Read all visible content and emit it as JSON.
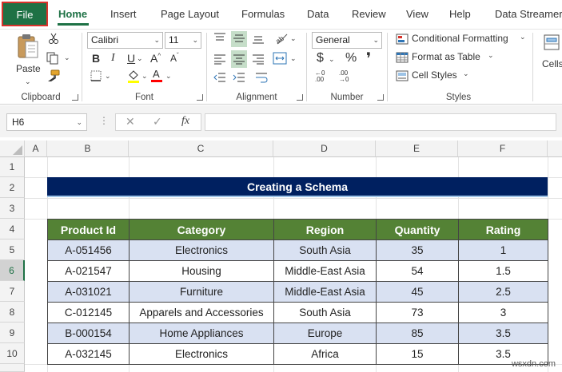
{
  "tabs": [
    {
      "label": "File"
    },
    {
      "label": "Home"
    },
    {
      "label": "Insert"
    },
    {
      "label": "Page Layout"
    },
    {
      "label": "Formulas"
    },
    {
      "label": "Data"
    },
    {
      "label": "Review"
    },
    {
      "label": "View"
    },
    {
      "label": "Help"
    },
    {
      "label": "Data Streamer"
    }
  ],
  "ribbon": {
    "clipboard": {
      "paste_label": "Paste",
      "group_label": "Clipboard"
    },
    "font": {
      "font_name": "Calibri",
      "font_size": "11",
      "group_label": "Font"
    },
    "alignment": {
      "group_label": "Alignment"
    },
    "number": {
      "format": "General",
      "group_label": "Number"
    },
    "styles": {
      "conditional_formatting": "Conditional Formatting",
      "format_as_table": "Format as Table",
      "cell_styles": "Cell Styles",
      "group_label": "Styles"
    },
    "cells": {
      "label": "Cells"
    }
  },
  "formula_bar": {
    "name_box": "H6",
    "formula": ""
  },
  "sheet": {
    "columns": [
      "A",
      "B",
      "C",
      "D",
      "E",
      "F"
    ],
    "rows": [
      "1",
      "2",
      "3",
      "4",
      "5",
      "6",
      "7",
      "8",
      "9",
      "10"
    ],
    "active_row": "6",
    "title": "Creating a Schema",
    "table": {
      "headers": [
        "Product Id",
        "Category",
        "Region",
        "Quantity",
        "Rating"
      ],
      "rows": [
        [
          "A-051456",
          "Electronics",
          "South Asia",
          "35",
          "1"
        ],
        [
          "A-021547",
          "Housing",
          "Middle-East Asia",
          "54",
          "1.5"
        ],
        [
          "A-031021",
          "Furniture",
          "Middle-East Asia",
          "45",
          "2.5"
        ],
        [
          "C-012145",
          "Apparels and Accessories",
          "South Asia",
          "73",
          "3"
        ],
        [
          "B-000154",
          "Home Appliances",
          "Europe",
          "85",
          "3.5"
        ],
        [
          "A-032145",
          "Electronics",
          "Africa",
          "15",
          "3.5"
        ]
      ]
    }
  },
  "watermark": "wsxdn.com"
}
